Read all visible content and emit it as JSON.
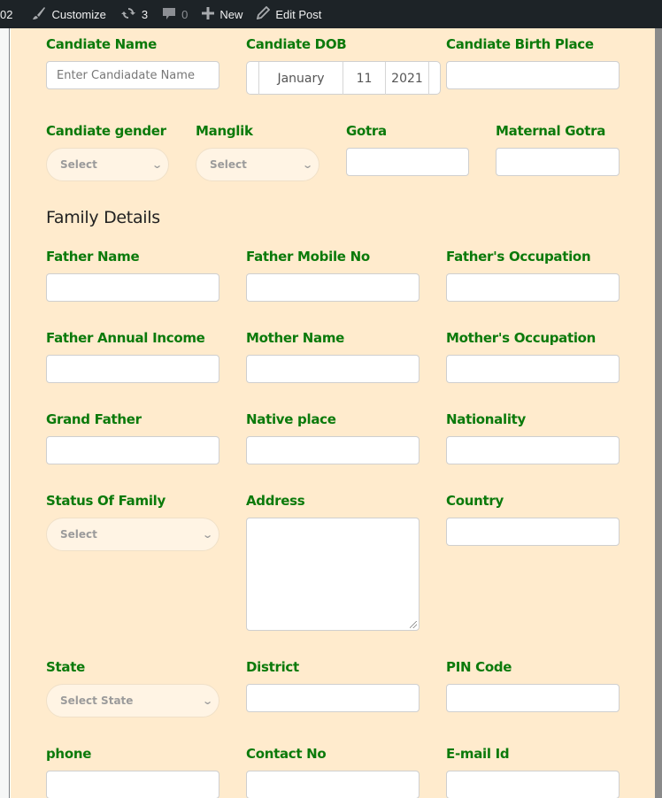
{
  "adminbar": {
    "site_fragment": "02",
    "customize": "Customize",
    "updates_count": "3",
    "comments_count": "0",
    "new": "New",
    "edit_post": "Edit Post"
  },
  "candidate": {
    "name_label": "Candiate Name",
    "name_placeholder": "Enter Candiadate Name",
    "dob_label": "Candiate DOB",
    "dob_month": "January",
    "dob_day": "11",
    "dob_year": "2021",
    "birth_place_label": "Candiate Birth Place",
    "gender_label": "Candiate gender",
    "gender_value": "Select",
    "manglik_label": "Manglik",
    "manglik_value": "Select",
    "gotra_label": "Gotra",
    "maternal_gotra_label": "Maternal Gotra"
  },
  "family": {
    "section_title": "Family Details",
    "father_name_label": "Father Name",
    "father_mobile_label": "Father Mobile No",
    "father_occupation_label": "Father's Occupation",
    "father_income_label": "Father Annual Income",
    "mother_name_label": "Mother Name",
    "mother_occupation_label": "Mother's Occupation",
    "grand_father_label": "Grand Father",
    "native_place_label": "Native place",
    "nationality_label": "Nationality",
    "status_label": "Status Of Family",
    "status_value": "Select",
    "address_label": "Address",
    "country_label": "Country",
    "state_label": "State",
    "state_value": "Select State",
    "district_label": "District",
    "pin_label": "PIN Code",
    "phone_label": "phone",
    "contact_label": "Contact No",
    "email_label": "E-mail Id"
  },
  "colors": {
    "label_green": "#0b7a0b",
    "form_background": "#ffebcd",
    "adminbar_background": "#1d2327"
  }
}
